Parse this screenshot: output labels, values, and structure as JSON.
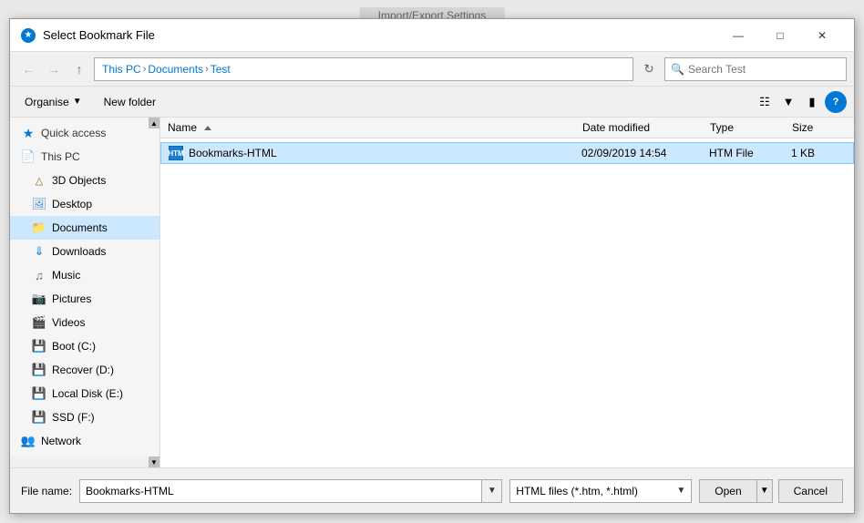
{
  "dialog": {
    "title": "Select Bookmark File",
    "icon": "★"
  },
  "title_controls": {
    "minimize": "—",
    "maximize": "□",
    "close": "✕"
  },
  "address_bar": {
    "back_title": "Back",
    "forward_title": "Forward",
    "up_title": "Up",
    "path": {
      "this_pc": "This PC",
      "documents": "Documents",
      "test": "Test"
    },
    "search_placeholder": "Search Test",
    "search_label": "Search"
  },
  "toolbar": {
    "organise_label": "Organise",
    "new_folder_label": "New folder"
  },
  "sidebar": {
    "quick_access_label": "Quick access",
    "this_pc_label": "This PC",
    "items": [
      {
        "id": "3d-objects",
        "label": "3D Objects",
        "indent": 1
      },
      {
        "id": "desktop",
        "label": "Desktop",
        "indent": 1
      },
      {
        "id": "documents",
        "label": "Documents",
        "indent": 1,
        "active": true
      },
      {
        "id": "downloads",
        "label": "Downloads",
        "indent": 1
      },
      {
        "id": "music",
        "label": "Music",
        "indent": 1
      },
      {
        "id": "pictures",
        "label": "Pictures",
        "indent": 1
      },
      {
        "id": "videos",
        "label": "Videos",
        "indent": 1
      },
      {
        "id": "boot-c",
        "label": "Boot (C:)",
        "indent": 1
      },
      {
        "id": "recover-d",
        "label": "Recover (D:)",
        "indent": 1
      },
      {
        "id": "local-disk-e",
        "label": "Local Disk (E:)",
        "indent": 1
      },
      {
        "id": "ssd-f",
        "label": "SSD (F:)",
        "indent": 1
      },
      {
        "id": "network",
        "label": "Network",
        "indent": 0
      }
    ]
  },
  "file_list": {
    "columns": {
      "name": "Name",
      "date_modified": "Date modified",
      "type": "Type",
      "size": "Size"
    },
    "files": [
      {
        "name": "Bookmarks-HTML",
        "date_modified": "02/09/2019 14:54",
        "type": "HTM File",
        "size": "1 KB",
        "selected": true
      }
    ]
  },
  "bottom_bar": {
    "file_name_label": "File name:",
    "file_name_value": "Bookmarks-HTML",
    "file_type_value": "HTML files (*.htm, *.html)",
    "open_label": "Open",
    "cancel_label": "Cancel"
  },
  "bg_window": {
    "title": "Import/Export Settings"
  }
}
